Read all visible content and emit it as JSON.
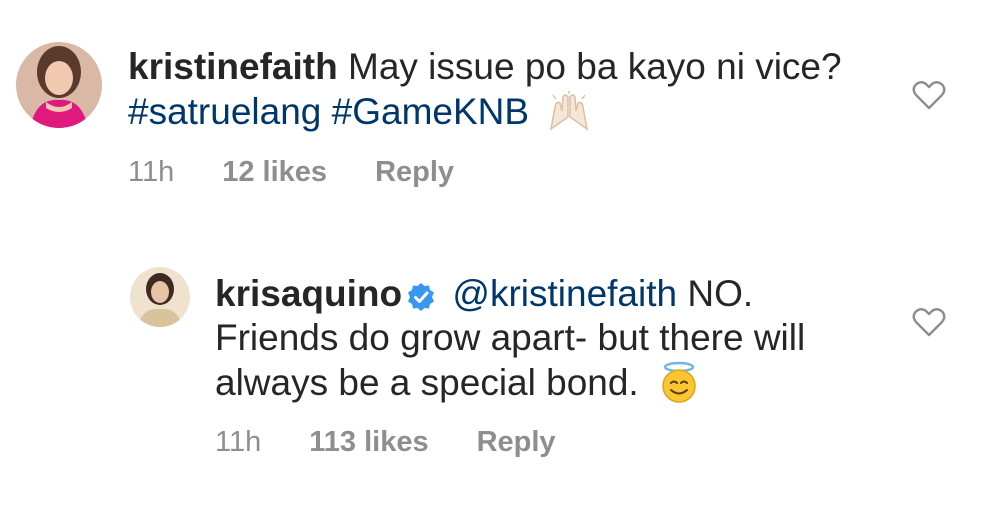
{
  "comments": [
    {
      "username": "kristinefaith",
      "text": "May issue po ba kayo ni vice?",
      "hashtags": [
        "#satruelang",
        "#GameKNB"
      ],
      "emoji": "raised-hands-emoji",
      "time": "11h",
      "likes": "12 likes",
      "reply_label": "Reply",
      "verified": false
    },
    {
      "username": "krisaquino",
      "mention": "@kristinefaith",
      "text": "NO. Friends do grow apart- but there will always be a special bond.",
      "emoji": "smiling-face-with-halo-emoji",
      "time": "11h",
      "likes": "113 likes",
      "reply_label": "Reply",
      "verified": true
    }
  ],
  "icons": {
    "like": "heart-outline-icon",
    "verified": "verified-badge-icon"
  },
  "colors": {
    "text": "#262626",
    "link": "#00376b",
    "secondary": "#8e8e8e",
    "verified": "#3897f0"
  }
}
